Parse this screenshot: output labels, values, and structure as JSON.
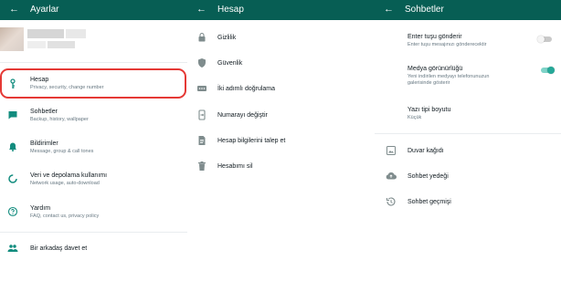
{
  "colors": {
    "header": "#075e54",
    "accent": "#128c7e",
    "highlight": "#e53935",
    "toggle_off": "#c9c9c9",
    "toggle_on": "#25a898"
  },
  "settings": {
    "title": "Ayarlar",
    "items": [
      {
        "label": "Hesap",
        "sub": "Privacy, security, change number",
        "icon": "key-icon"
      },
      {
        "label": "Sohbetler",
        "sub": "Backup, history, wallpaper",
        "icon": "chat-icon"
      },
      {
        "label": "Bildirimler",
        "sub": "Message, group & call tones",
        "icon": "bell-icon"
      },
      {
        "label": "Veri ve depolama kullanımı",
        "sub": "Network usage, auto-download",
        "icon": "data-usage-icon"
      },
      {
        "label": "Yardım",
        "sub": "FAQ, contact us, privacy policy",
        "icon": "help-icon"
      },
      {
        "label": "Bir arkadaş davet et",
        "icon": "people-icon"
      }
    ]
  },
  "account": {
    "title": "Hesap",
    "items": [
      {
        "label": "Gizlilik",
        "icon": "lock-icon"
      },
      {
        "label": "Güvenlik",
        "icon": "shield-icon"
      },
      {
        "label": "İki adımlı doğrulama",
        "icon": "dots-pin-icon"
      },
      {
        "label": "Numarayı değiştir",
        "icon": "phone-change-icon"
      },
      {
        "label": "Hesap bilgilerini talep et",
        "icon": "document-icon"
      },
      {
        "label": "Hesabımı sil",
        "icon": "trash-icon"
      }
    ]
  },
  "chats": {
    "title": "Sohbetler",
    "enter_send": {
      "label": "Enter tuşu gönderir",
      "sub": "Enter tuşu mesajınızı gönderecektir",
      "on": false
    },
    "media_visibility": {
      "label": "Medya görünürlüğü",
      "sub1": "Yeni indirilen medyayı telefonunuzun",
      "sub2": "galerisinde gösterir",
      "on": true
    },
    "font_size": {
      "label": "Yazı tipi boyutu",
      "value": "Küçük"
    },
    "items": [
      {
        "label": "Duvar kağıdı",
        "icon": "wallpaper-icon"
      },
      {
        "label": "Sohbet yedeği",
        "icon": "cloud-upload-icon"
      },
      {
        "label": "Sohbet geçmişi",
        "icon": "history-icon"
      }
    ]
  }
}
